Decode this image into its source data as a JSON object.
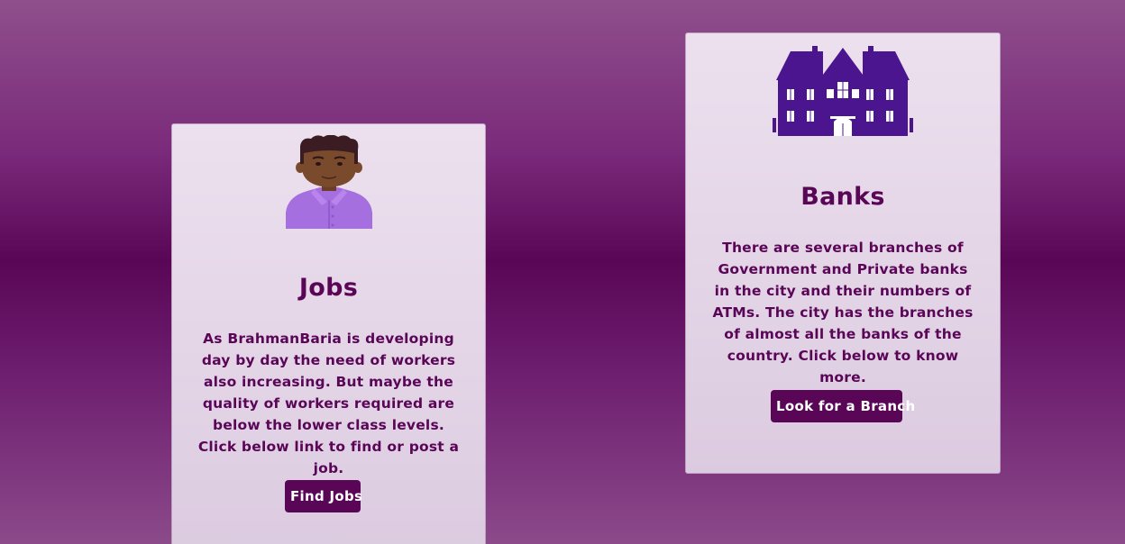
{
  "cards": [
    {
      "id": "jobs",
      "image_icon": "person-avatar-icon",
      "title": "Jobs",
      "description": "As BrahmanBaria is developing day by day the need of workers also increasing. But maybe the quality of workers required are below the lower class levels. Click below link to find or post a job.",
      "button_label": "Find Jobs"
    },
    {
      "id": "banks",
      "image_icon": "bank-building-icon",
      "title": "Banks",
      "description": "There are several branches of Government and Private banks in the city and their numbers of ATMs. The city has the branches of almost all the banks of the country. Click below to know more.",
      "button_label": "Look for a Branch"
    }
  ],
  "colors": {
    "accent": "#5a0657",
    "card_background": "#e6d8e8",
    "button_text": "#ffffff",
    "building": "#4a158f",
    "shirt": "#a66fe0",
    "skin": "#7a4a2c",
    "hair": "#3a1c22"
  }
}
